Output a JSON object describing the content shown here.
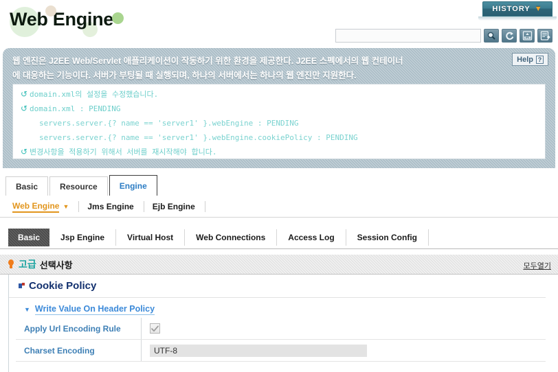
{
  "header": {
    "page_title": "Web Engine",
    "history_button": {
      "label": "HISTORY",
      "caret": "❯",
      "icon": "chevron-down-icon"
    },
    "search": {
      "value": "",
      "placeholder": ""
    },
    "toolbar_icons": [
      {
        "name": "search-icon",
        "title": "Search"
      },
      {
        "name": "refresh-icon",
        "title": "Refresh"
      },
      {
        "name": "export-xml-icon",
        "title": "Export XML"
      },
      {
        "name": "export-icon",
        "title": "Export"
      }
    ]
  },
  "banner": {
    "description_line1": "웹 엔진은 J2EE Web/Servlet 애플리케이션이 작동하기 위한 환경을 제공한다. J2EE 스펙에서의 웹 컨테이너",
    "description_line2": "에 대응하는 기능이다. 서버가 부팅될 때 실행되며, 하나의 서버에서는 하나의 웹 엔진만 지원한다.",
    "help_label": "Help",
    "help_icon_char": "?",
    "messages": [
      {
        "icon": "sync-icon",
        "indent": false,
        "text": "domain.xml의 설정을 수정했습니다."
      },
      {
        "icon": "sync-icon",
        "indent": false,
        "text": "domain.xml : PENDING"
      },
      {
        "icon": "",
        "indent": true,
        "text": "servers.server.{? name == 'server1' }.webEngine : PENDING"
      },
      {
        "icon": "",
        "indent": true,
        "text": "servers.server.{? name == 'server1' }.webEngine.cookiePolicy : PENDING"
      },
      {
        "icon": "sync-icon",
        "indent": false,
        "text": "변경사항을 적용하기 위해서 서버를 재시작해야 합니다."
      }
    ]
  },
  "top_tabs": [
    {
      "label": "Basic",
      "active": false
    },
    {
      "label": "Resource",
      "active": false
    },
    {
      "label": "Engine",
      "active": true
    }
  ],
  "sub_nav": [
    {
      "label": "Web Engine",
      "active": true,
      "has_caret": true
    },
    {
      "label": "Jms Engine",
      "active": false,
      "has_caret": false
    },
    {
      "label": "Ejb Engine",
      "active": false,
      "has_caret": false
    }
  ],
  "sub_tabs": [
    {
      "label": "Basic",
      "active": true
    },
    {
      "label": "Jsp Engine",
      "active": false
    },
    {
      "label": "Virtual Host",
      "active": false
    },
    {
      "label": "Web Connections",
      "active": false
    },
    {
      "label": "Access Log",
      "active": false
    },
    {
      "label": "Session Config",
      "active": false
    }
  ],
  "advanced": {
    "keyword": "고급",
    "label": "선택사항",
    "expand_all_link": "모두열기"
  },
  "content": {
    "section_title": "Cookie Policy",
    "group_title": "Write Value On Header Policy",
    "fields": [
      {
        "label": "Apply Url Encoding Rule",
        "type": "checkbox",
        "checked": true,
        "disabled": true,
        "value": ""
      },
      {
        "label": "Charset Encoding",
        "type": "text",
        "checked": false,
        "disabled": true,
        "value": "UTF-8"
      }
    ]
  },
  "colors": {
    "accent_orange": "#e2951c",
    "accent_teal": "#1aa3a0",
    "link_blue": "#3c8ad9",
    "title_navy": "#12306e",
    "banner_bg": "#a9bcc6",
    "message_text": "#6ecfcb",
    "history_bg": "#2d6578",
    "label_blue": "#3d7fb5"
  }
}
